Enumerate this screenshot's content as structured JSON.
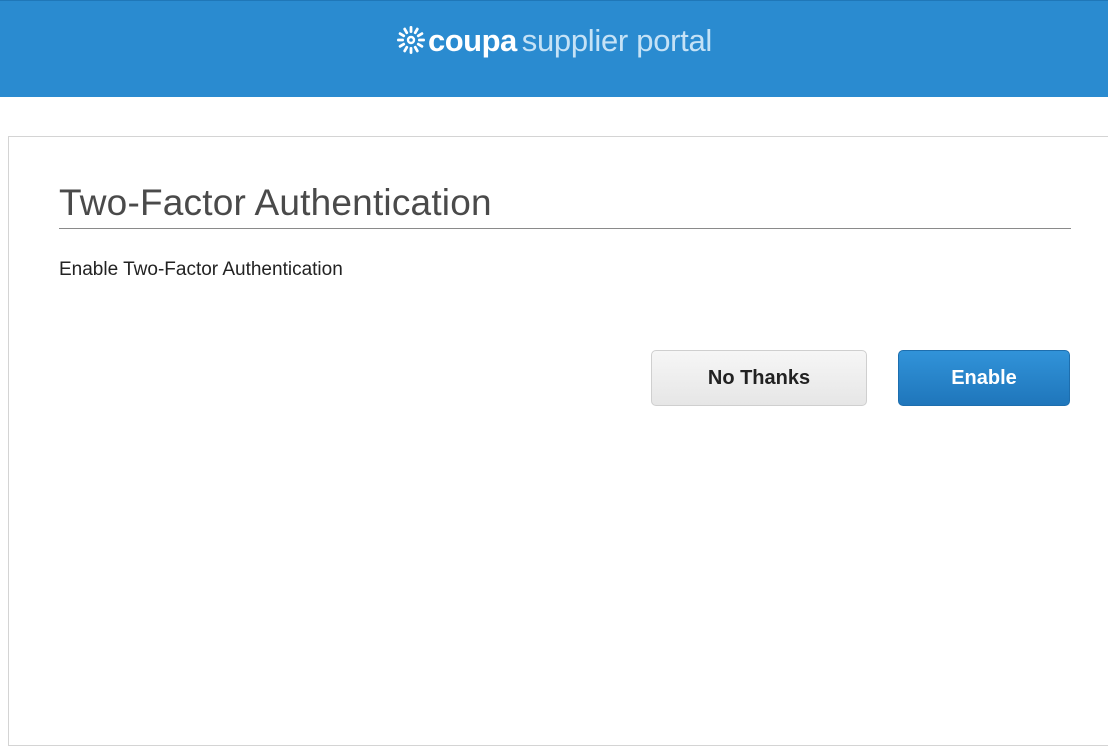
{
  "header": {
    "brand": "coupa",
    "product": "supplier portal",
    "logo_icon": "coupa-starburst-icon",
    "background_color": "#2a8bd0"
  },
  "main": {
    "title": "Two-Factor Authentication",
    "subtitle": "Enable Two-Factor Authentication",
    "buttons": {
      "no_thanks_label": "No Thanks",
      "enable_label": "Enable"
    },
    "accent_color": "#2a8bd0"
  }
}
